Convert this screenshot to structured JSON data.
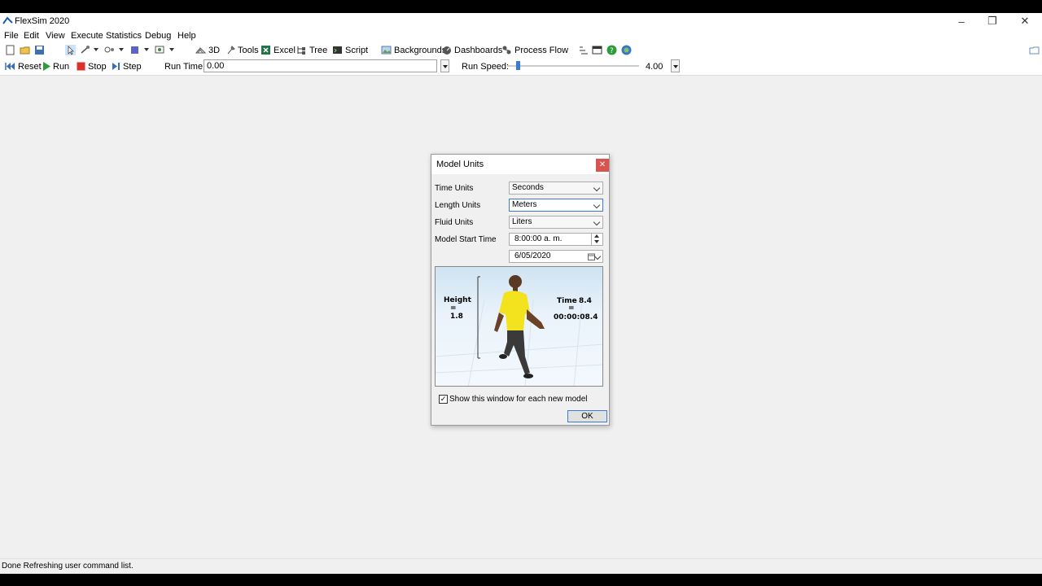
{
  "window": {
    "title": "FlexSim 2020"
  },
  "menu": [
    "File",
    "Edit",
    "View",
    "Execute",
    "Statistics",
    "Debug",
    "Help"
  ],
  "toolbar": {
    "view3d": "3D",
    "tools": "Tools",
    "excel": "Excel",
    "tree": "Tree",
    "script": "Script",
    "backgrounds": "Backgrounds",
    "dashboards": "Dashboards",
    "process_flow": "Process Flow"
  },
  "runbar": {
    "reset": "Reset",
    "run": "Run",
    "stop": "Stop",
    "step": "Step",
    "run_time_label": "Run Time:",
    "run_time_value": "0.00",
    "run_speed_label": "Run Speed:",
    "run_speed_value": "4.00"
  },
  "dialog": {
    "title": "Model Units",
    "time_units_label": "Time Units",
    "time_units_value": "Seconds",
    "length_units_label": "Length Units",
    "length_units_value": "Meters",
    "fluid_units_label": "Fluid Units",
    "fluid_units_value": "Liters",
    "start_time_label": "Model Start Time",
    "start_time_value": "8:00:00 a. m.",
    "start_date_value": "6/05/2020",
    "preview": {
      "height_label": "Height",
      "height_value": "1.8",
      "time_label": "Time",
      "time_value": "8.4",
      "time_clock": "00:00:08.4"
    },
    "show_checkbox_label": "Show this window for each new model",
    "ok": "OK"
  },
  "status": "Done Refreshing user command list."
}
